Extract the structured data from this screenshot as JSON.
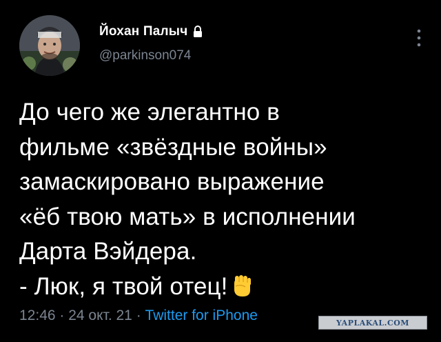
{
  "author": {
    "display_name": "Йохан Палыч",
    "handle": "@parkinson074",
    "avatar_icon": "profile-photo",
    "protected_icon": "lock-icon"
  },
  "tweet": {
    "lines": [
      "До чего же элегантно в",
      "фильме «звёздные войны»",
      "замаскировано выражение",
      "«ёб твою мать» в исполнении",
      "Дарта Вэйдера.",
      "- Люк, я твой отец!"
    ],
    "emoji": "raised-fist-emoji"
  },
  "meta": {
    "time": "12:46",
    "separator": " · ",
    "date": "24 окт. 21",
    "source": "Twitter for iPhone"
  },
  "watermark": {
    "text": "YAPLAKAL.COM"
  },
  "colors": {
    "background": "#000000",
    "text": "#ffffff",
    "secondary": "#7c8591",
    "link": "#1d9bf0"
  }
}
